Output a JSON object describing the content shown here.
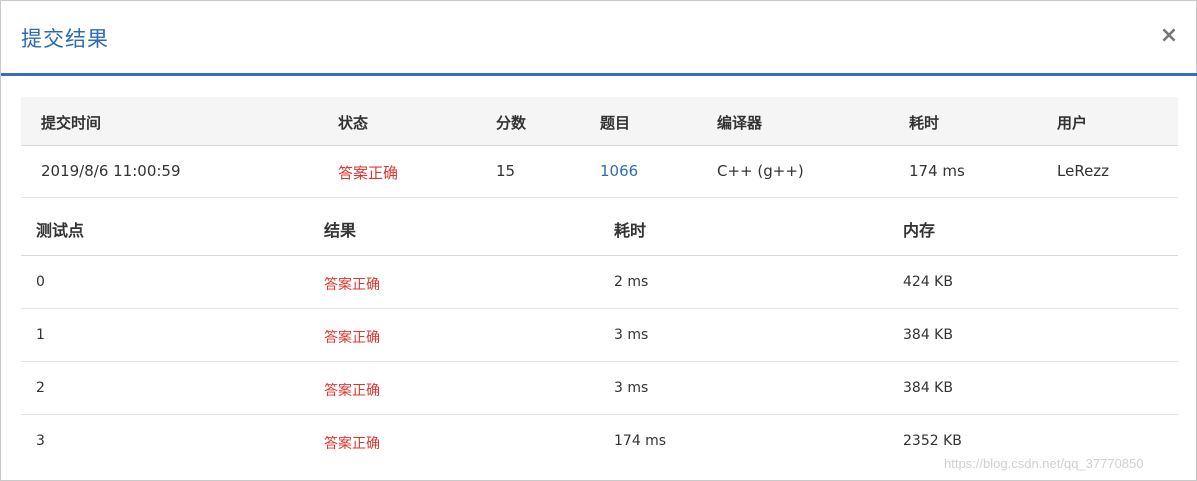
{
  "dialog": {
    "title": "提交结果",
    "close_label": "×"
  },
  "summary": {
    "headers": [
      "提交时间",
      "状态",
      "分数",
      "题目",
      "编译器",
      "耗时",
      "用户"
    ],
    "row": {
      "time": "2019/8/6 11:00:59",
      "status": "答案正确",
      "score": "15",
      "problem": "1066",
      "compiler": "C++ (g++)",
      "elapsed": "174 ms",
      "user": "LeRezz"
    }
  },
  "cases": {
    "headers": [
      "测试点",
      "结果",
      "耗时",
      "内存"
    ],
    "rows": [
      {
        "id": "0",
        "result": "答案正确",
        "time": "2 ms",
        "memory": "424 KB"
      },
      {
        "id": "1",
        "result": "答案正确",
        "time": "3 ms",
        "memory": "384 KB"
      },
      {
        "id": "2",
        "result": "答案正确",
        "time": "3 ms",
        "memory": "384 KB"
      },
      {
        "id": "3",
        "result": "答案正确",
        "time": "174 ms",
        "memory": "2352 KB"
      }
    ]
  },
  "watermark": "https://blog.csdn.net/qq_37770850",
  "colors": {
    "accent": "#3a6db5",
    "title": "#2f6bb5",
    "success": "#e0352f",
    "link": "#2f6bb5"
  }
}
